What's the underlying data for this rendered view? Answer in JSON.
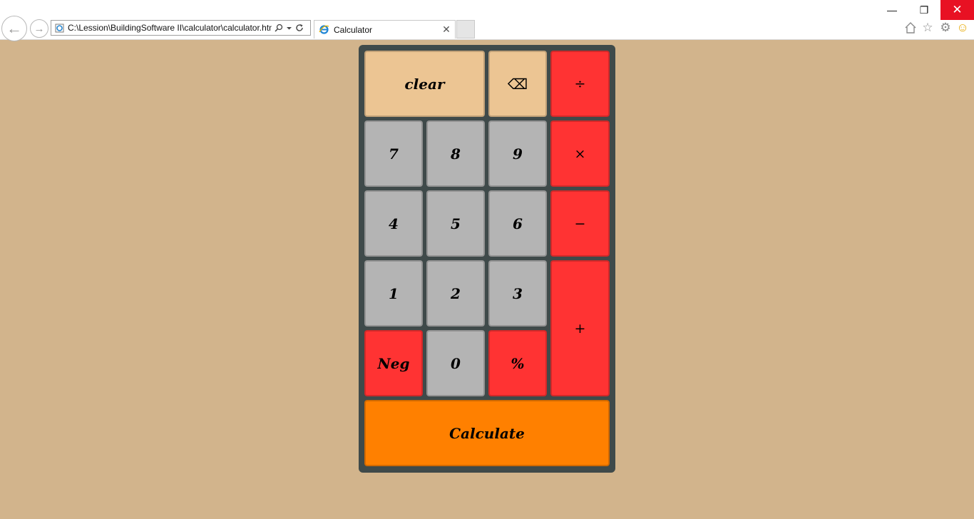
{
  "browser": {
    "address": "C:\\Lession\\BuildingSoftware II\\calculator\\calculator.html",
    "tab_title": "Calculator",
    "icons": {
      "back": "back-arrow-icon",
      "forward": "forward-arrow-icon",
      "search": "search-icon",
      "dropdown": "chevron-down-icon",
      "refresh": "refresh-icon",
      "close_tab": "close-icon",
      "home": "home-icon",
      "favorites": "star-icon",
      "settings": "gear-icon",
      "feedback": "smiley-icon"
    },
    "window_controls": {
      "minimize": "—",
      "maximize": "❐",
      "close": "✕"
    },
    "close_tab_glyph": "✕"
  },
  "calculator": {
    "colors": {
      "frame": "#3f4a4a",
      "number_key": "#b4b4b4",
      "operator_key": "#ff3333",
      "clear_key": "#ecc593",
      "calculate_key": "#ff8000",
      "page_background": "#d2b48c"
    },
    "keys": {
      "clear": "clear",
      "backspace": "⌫",
      "divide": "÷",
      "multiply": "×",
      "subtract": "−",
      "add": "+",
      "seven": "7",
      "eight": "8",
      "nine": "9",
      "four": "4",
      "five": "5",
      "six": "6",
      "one": "1",
      "two": "2",
      "three": "3",
      "neg": "Neg",
      "zero": "0",
      "percent": "%",
      "calculate": "Calculate"
    }
  }
}
